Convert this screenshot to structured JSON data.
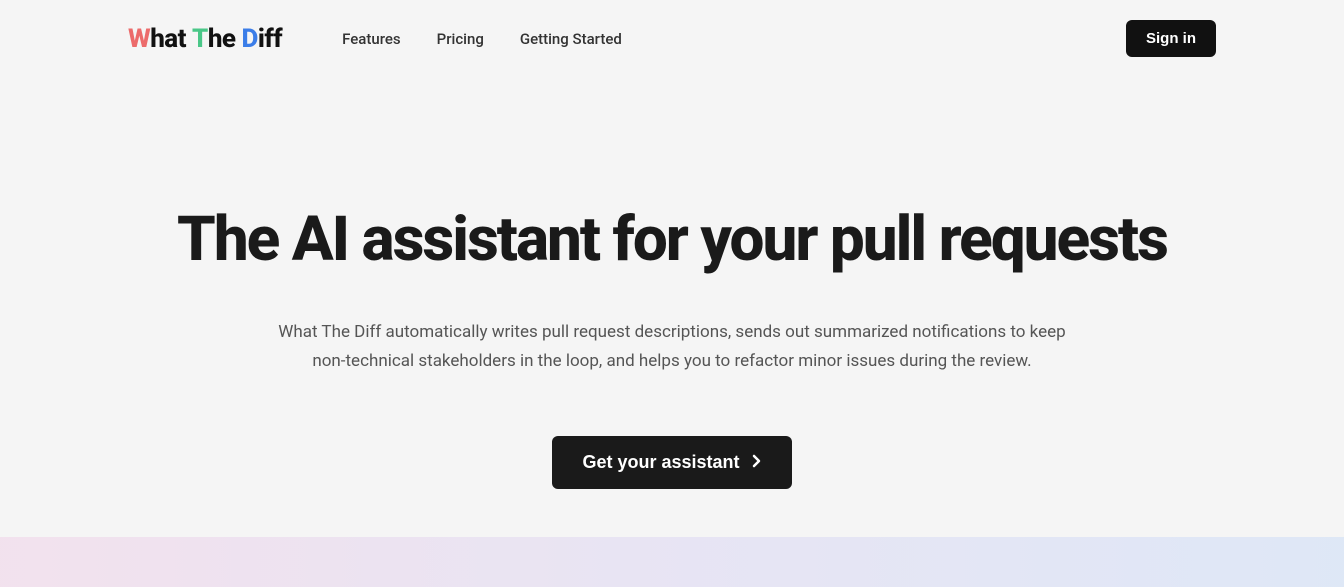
{
  "logo": {
    "word1_rest": "hat",
    "word2_rest": "he",
    "word3_rest": "iff"
  },
  "nav": {
    "features": "Features",
    "pricing": "Pricing",
    "getting_started": "Getting Started"
  },
  "header": {
    "sign_in": "Sign in"
  },
  "hero": {
    "title": "The AI assistant for your pull requests",
    "description": "What The Diff automatically writes pull request descriptions, sends out summarized notifications to keep non-technical stakeholders in the loop, and helps you to refactor minor issues during the review.",
    "cta": "Get your assistant"
  }
}
